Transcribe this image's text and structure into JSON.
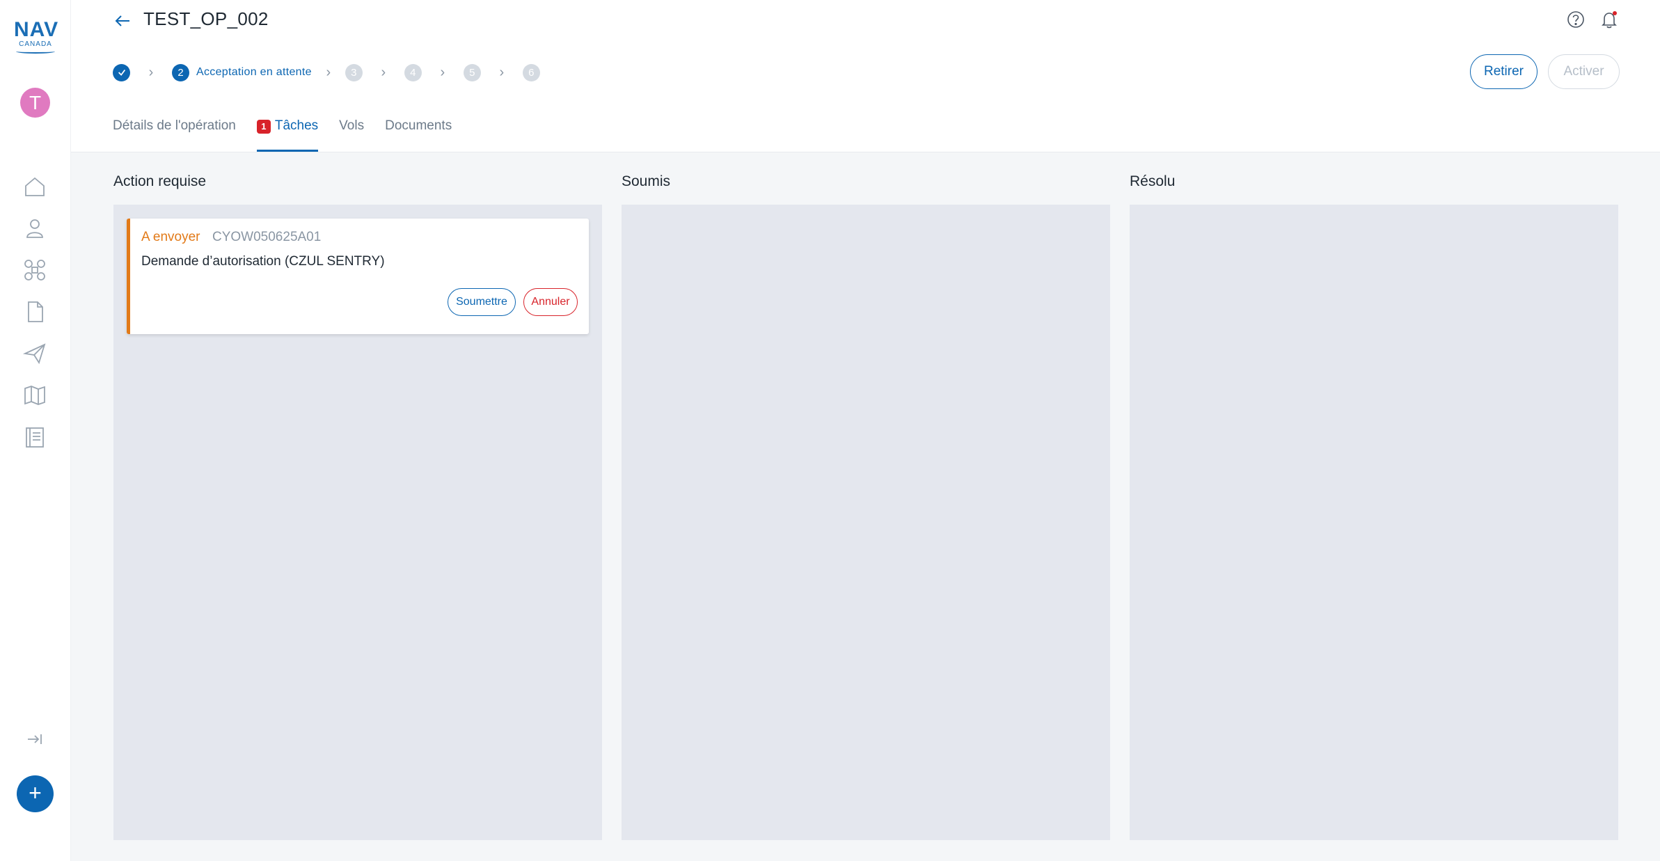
{
  "logo": {
    "top": "NAV",
    "bottom": "CANADA"
  },
  "user": {
    "initial": "T"
  },
  "sidebar": {
    "icons": [
      "home-icon",
      "user-icon",
      "drone-icon",
      "document-icon",
      "send-icon",
      "map-icon",
      "logbook-icon"
    ],
    "collapse_icon": "collapse-icon",
    "fab_label": "+"
  },
  "header": {
    "title": "TEST_OP_002",
    "stepper": {
      "step2_number": "2",
      "step2_label": "Acceptation en attente",
      "step3": "3",
      "step4": "4",
      "step5": "5",
      "step6": "6"
    },
    "buttons": {
      "retirer": "Retirer",
      "activer": "Activer"
    },
    "tabs": {
      "details": "Détails de l'opération",
      "taches_badge": "1",
      "taches": "Tâches",
      "vols": "Vols",
      "documents": "Documents"
    }
  },
  "columns": {
    "action": "Action requise",
    "soumis": "Soumis",
    "resolu": "Résolu"
  },
  "card": {
    "status": "A envoyer",
    "code": "CYOW050625A01",
    "description": "Demande d’autorisation (CZUL SENTRY)",
    "submit": "Soumettre",
    "cancel": "Annuler"
  },
  "colors": {
    "primary": "#0c66b2",
    "warning": "#e27a18",
    "danger": "#d8232a",
    "avatar": "#e07ac0"
  }
}
